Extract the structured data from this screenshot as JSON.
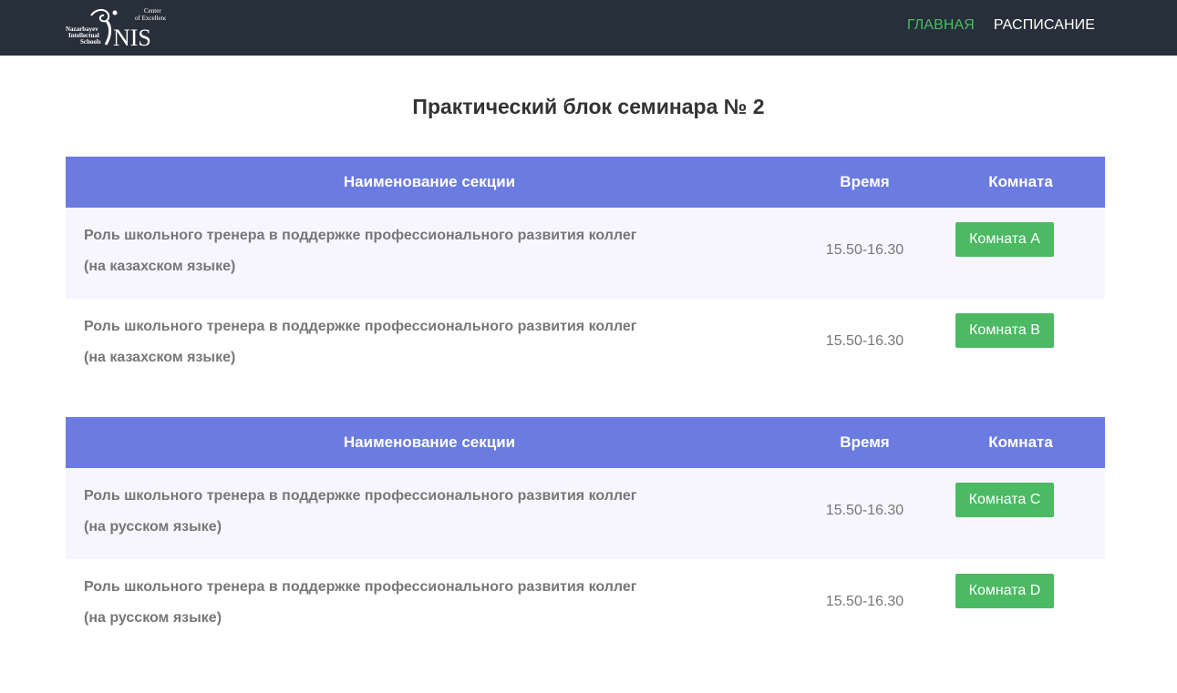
{
  "header": {
    "logo": {
      "words": [
        "Nazarbayev",
        "Intellectual",
        "Schools"
      ],
      "tagline": [
        "Center",
        "of Excellence"
      ],
      "mark": "NIS"
    },
    "nav": [
      {
        "label": "ГЛАВНАЯ",
        "active": true
      },
      {
        "label": "РАСПИСАНИЕ",
        "active": false
      }
    ]
  },
  "colors": {
    "navbar": "#272f3a",
    "accent_green": "#4cb963",
    "table_header": "#6b7be0",
    "row_alt": "#f7f6fe"
  },
  "page_title": "Практический блок семинара № 2",
  "tables": [
    {
      "headers": {
        "name": "Наименование секции",
        "time": "Время",
        "room": "Комната"
      },
      "rows": [
        {
          "title": "Роль школьного тренера в поддержке профессионального развития коллег",
          "language": "(на казахском языке)",
          "time": "15.50-16.30",
          "room": "Комната A"
        },
        {
          "title": "Роль школьного тренера в поддержке профессионального развития коллег",
          "language": "(на казахском языке)",
          "time": "15.50-16.30",
          "room": "Комната B"
        }
      ]
    },
    {
      "headers": {
        "name": "Наименование секции",
        "time": "Время",
        "room": "Комната"
      },
      "rows": [
        {
          "title": "Роль школьного тренера в поддержке профессионального развития коллег",
          "language": "(на русском языке)",
          "time": "15.50-16.30",
          "room": "Комната C"
        },
        {
          "title": "Роль школьного тренера в поддержке профессионального развития коллег",
          "language": "(на русском языке)",
          "time": "15.50-16.30",
          "room": "Комната D"
        }
      ]
    }
  ]
}
